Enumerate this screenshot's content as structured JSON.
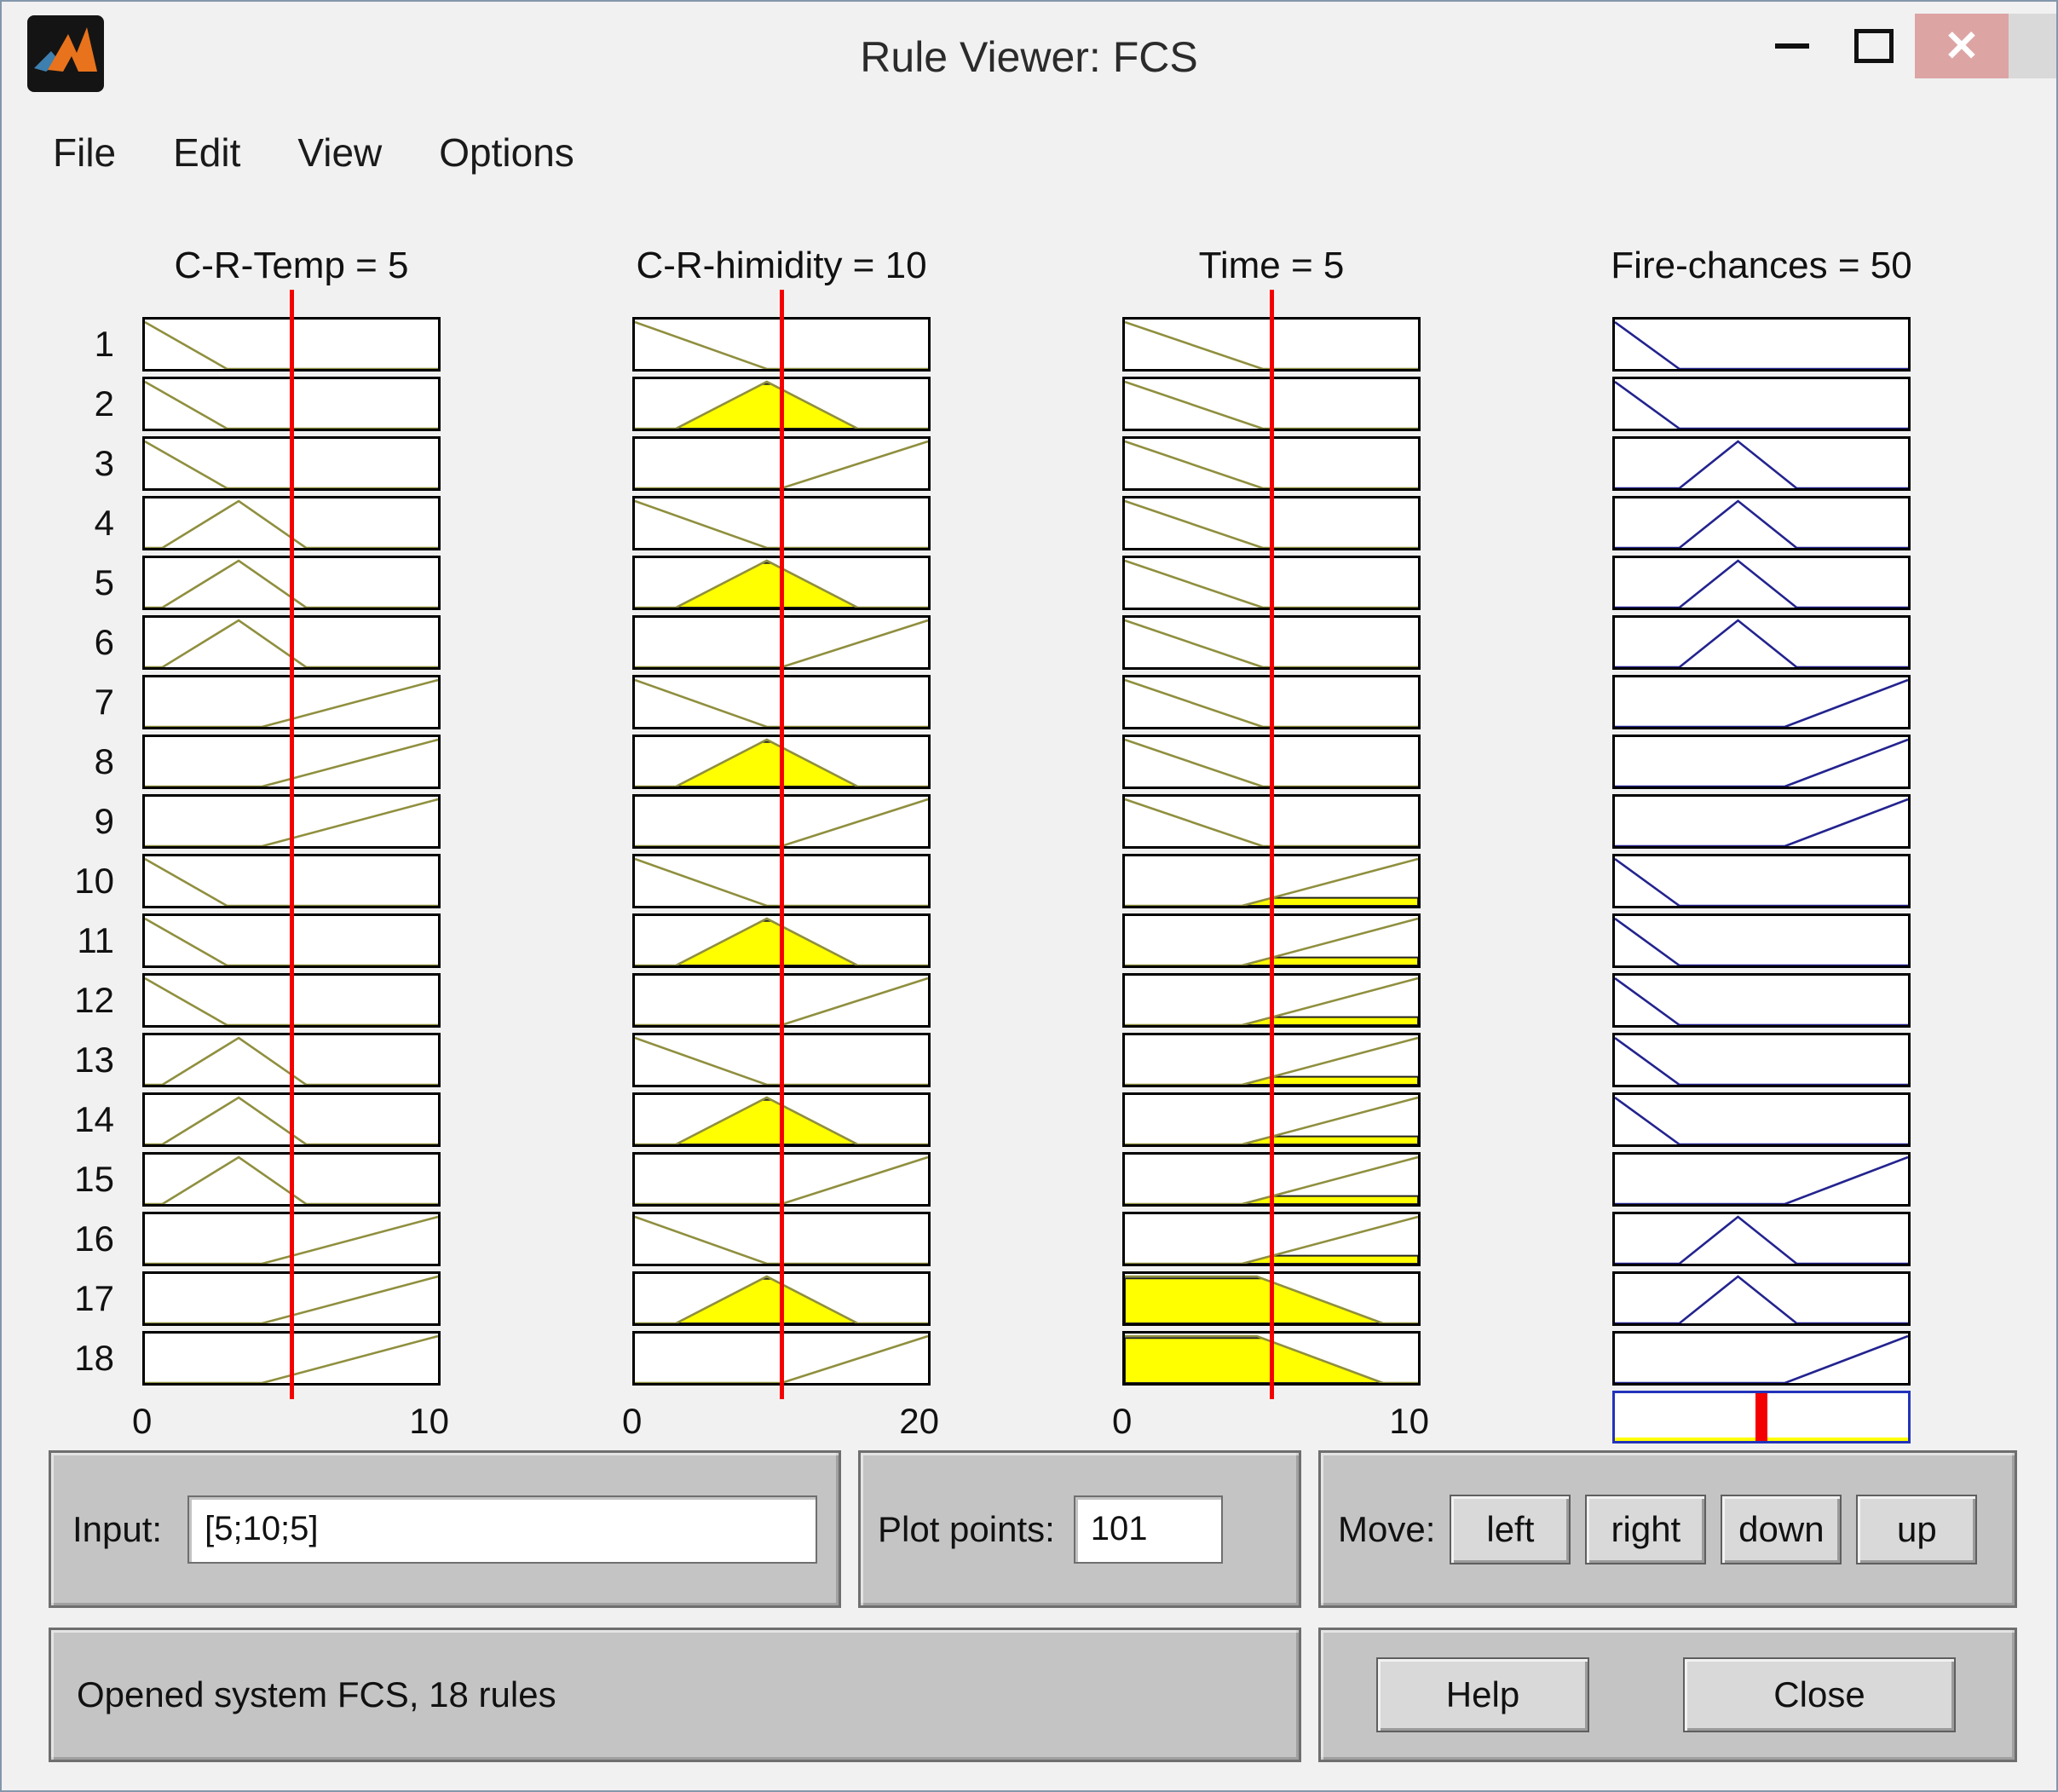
{
  "window": {
    "title": "Rule Viewer: FCS",
    "controls": {
      "minimize": "minimize",
      "maximize": "maximize",
      "close_glyph": "✕"
    }
  },
  "menu": {
    "items": [
      "File",
      "Edit",
      "View",
      "Options"
    ]
  },
  "colors": {
    "input_stroke": "#8f8f3f",
    "output_stroke": "#23238f",
    "active_fill": "#ffff00",
    "input_line": "#f50000",
    "aggregate_border": "#2233bb"
  },
  "chart_data": {
    "type": "rule-viewer",
    "num_rules": 18,
    "inputs": [
      {
        "name": "C-R-Temp",
        "value": 5,
        "range": [
          0,
          10
        ]
      },
      {
        "name": "C-R-himidity",
        "value": 10,
        "range": [
          0,
          20
        ]
      },
      {
        "name": "Time",
        "value": 5,
        "range": [
          0,
          10
        ]
      }
    ],
    "output": {
      "name": "Fire-chances",
      "value": 50,
      "range": [
        0,
        100
      ]
    },
    "columns": [
      {
        "key": "c-r-temp",
        "title": "C-R-Temp = 5",
        "kind": "input",
        "axis_min": "0",
        "axis_max": "10",
        "line_pos": 0.5
      },
      {
        "key": "c-r-himidity",
        "title": "C-R-himidity = 10",
        "kind": "input",
        "axis_min": "0",
        "axis_max": "20",
        "line_pos": 0.5
      },
      {
        "key": "time",
        "title": "Time = 5",
        "kind": "input",
        "axis_min": "0",
        "axis_max": "10",
        "line_pos": 0.5
      },
      {
        "key": "fire-chances",
        "title": "Fire-chances = 50",
        "kind": "output"
      }
    ],
    "mfs": {
      "temp_low": {
        "t": "down",
        "p": [
          0.28
        ]
      },
      "temp_med": {
        "t": "tri",
        "p": [
          0.06,
          0.32,
          0.55
        ]
      },
      "temp_high": {
        "t": "up",
        "p": [
          0.4
        ]
      },
      "hum_low": {
        "t": "down",
        "p": [
          0.45
        ]
      },
      "hum_med": {
        "t": "tri",
        "p": [
          0.14,
          0.45,
          0.76
        ]
      },
      "hum_high": {
        "t": "up",
        "p": [
          0.5
        ]
      },
      "time_slow": {
        "t": "down",
        "p": [
          0.47
        ]
      },
      "time_fast": {
        "t": "up",
        "p": [
          0.4
        ]
      },
      "time_trap": {
        "t": "trap",
        "p": [
          0.45,
          0.88
        ]
      },
      "fire_low": {
        "t": "down",
        "p": [
          0.22
        ]
      },
      "fire_med": {
        "t": "tri",
        "p": [
          0.22,
          0.42,
          0.62
        ]
      },
      "fire_high": {
        "t": "up",
        "p": [
          0.58
        ]
      }
    },
    "rows": [
      {
        "n": "1",
        "mf": [
          "temp_low",
          "hum_low",
          "time_slow",
          "fire_low"
        ],
        "fill": [
          0,
          0,
          0,
          0
        ]
      },
      {
        "n": "2",
        "mf": [
          "temp_low",
          "hum_med",
          "time_slow",
          "fire_low"
        ],
        "fill": [
          0,
          0.95,
          0,
          0
        ]
      },
      {
        "n": "3",
        "mf": [
          "temp_low",
          "hum_high",
          "time_slow",
          "fire_med"
        ],
        "fill": [
          0,
          0,
          0,
          0
        ]
      },
      {
        "n": "4",
        "mf": [
          "temp_med",
          "hum_low",
          "time_slow",
          "fire_med"
        ],
        "fill": [
          0,
          0,
          0,
          0
        ]
      },
      {
        "n": "5",
        "mf": [
          "temp_med",
          "hum_med",
          "time_slow",
          "fire_med"
        ],
        "fill": [
          0,
          0.95,
          0,
          0
        ]
      },
      {
        "n": "6",
        "mf": [
          "temp_med",
          "hum_high",
          "time_slow",
          "fire_med"
        ],
        "fill": [
          0,
          0,
          0,
          0
        ]
      },
      {
        "n": "7",
        "mf": [
          "temp_high",
          "hum_low",
          "time_slow",
          "fire_high"
        ],
        "fill": [
          0,
          0,
          0,
          0
        ]
      },
      {
        "n": "8",
        "mf": [
          "temp_high",
          "hum_med",
          "time_slow",
          "fire_high"
        ],
        "fill": [
          0,
          0.95,
          0,
          0
        ]
      },
      {
        "n": "9",
        "mf": [
          "temp_high",
          "hum_high",
          "time_slow",
          "fire_high"
        ],
        "fill": [
          0,
          0,
          0,
          0
        ]
      },
      {
        "n": "10",
        "mf": [
          "temp_low",
          "hum_low",
          "time_fast",
          "fire_low"
        ],
        "fill": [
          0,
          0,
          0.17,
          0
        ]
      },
      {
        "n": "11",
        "mf": [
          "temp_low",
          "hum_med",
          "time_fast",
          "fire_low"
        ],
        "fill": [
          0,
          0.95,
          0.17,
          0
        ]
      },
      {
        "n": "12",
        "mf": [
          "temp_low",
          "hum_high",
          "time_fast",
          "fire_low"
        ],
        "fill": [
          0,
          0,
          0.17,
          0
        ]
      },
      {
        "n": "13",
        "mf": [
          "temp_med",
          "hum_low",
          "time_fast",
          "fire_low"
        ],
        "fill": [
          0,
          0,
          0.17,
          0
        ]
      },
      {
        "n": "14",
        "mf": [
          "temp_med",
          "hum_med",
          "time_fast",
          "fire_low"
        ],
        "fill": [
          0,
          0.95,
          0.17,
          0
        ]
      },
      {
        "n": "15",
        "mf": [
          "temp_med",
          "hum_high",
          "time_fast",
          "fire_high"
        ],
        "fill": [
          0,
          0,
          0.17,
          0
        ]
      },
      {
        "n": "16",
        "mf": [
          "temp_high",
          "hum_low",
          "time_fast",
          "fire_med"
        ],
        "fill": [
          0,
          0,
          0.17,
          0
        ]
      },
      {
        "n": "17",
        "mf": [
          "temp_high",
          "hum_med",
          "time_trap",
          "fire_med"
        ],
        "fill": [
          0,
          0.95,
          0.96,
          0
        ]
      },
      {
        "n": "18",
        "mf": [
          "temp_high",
          "hum_high",
          "time_trap",
          "fire_high"
        ],
        "fill": [
          0,
          0,
          0.96,
          0
        ]
      }
    ],
    "aggregate": {
      "marker_pos": 0.5,
      "fill_level": 0.07
    }
  },
  "controls": {
    "input_label": "Input:",
    "input_value": "[5;10;5]",
    "plot_points_label": "Plot points:",
    "plot_points_value": "101",
    "move_label": "Move:",
    "move_buttons": [
      "left",
      "right",
      "down",
      "up"
    ],
    "help_label": "Help",
    "close_label": "Close"
  },
  "status": {
    "message": "Opened system FCS, 18 rules"
  }
}
